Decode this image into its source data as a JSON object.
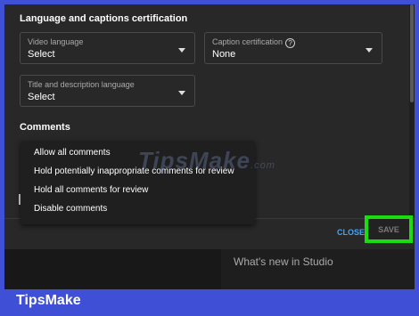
{
  "language_section": {
    "title": "Language and captions certification",
    "video_language": {
      "label": "Video language",
      "value": "Select"
    },
    "caption_certification": {
      "label": "Caption certification",
      "value": "None"
    },
    "title_description_language": {
      "label": "Title and description language",
      "value": "Select"
    }
  },
  "comments_section": {
    "title": "Comments",
    "menu_items": [
      "Allow all comments",
      "Hold potentially inappropriate comments for review",
      "Hold all comments for review",
      "Disable comments"
    ]
  },
  "footer": {
    "close_label": "CLOSE",
    "save_label": "SAVE",
    "highlight_color": "#1bdc0f",
    "close_color": "#3ea6ff"
  },
  "studio_panel": {
    "text": "What's new in Studio"
  },
  "watermark": {
    "text": "TipsMake",
    "suffix": ".com"
  },
  "brand": {
    "text": "TipsMake"
  }
}
